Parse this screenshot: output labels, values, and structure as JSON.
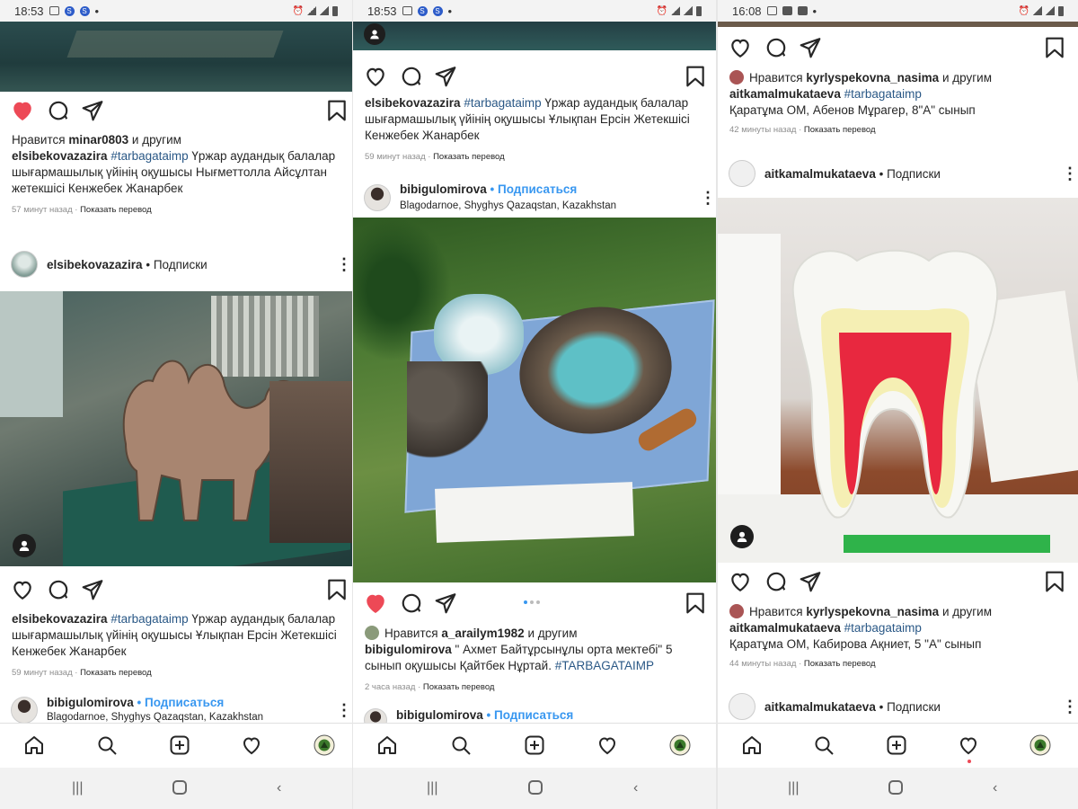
{
  "icons": {
    "heart": "heart-icon",
    "comment": "comment-icon",
    "share": "share-icon",
    "bookmark": "bookmark-icon",
    "home": "home-icon",
    "search": "search-icon",
    "add": "add-icon",
    "activity": "activity-icon",
    "profile": "profile-avatar-icon",
    "person": "person-icon",
    "more": "more-icon"
  },
  "colors": {
    "liked": "#ed4956",
    "link": "#3897f0",
    "hashtag": "#2a5886"
  },
  "p1": {
    "time": "18:53",
    "post1": {
      "liked_by_prefix": "Нравится",
      "liked_by_user": "minar0803",
      "liked_by_suffix": "и другим",
      "author": "elsibekovazazira",
      "hashtag": "#tarbagataimp",
      "caption": "Үржар аудандық балалар шығармашылық үйінің оқушысы Нығметтолла Айсұлтан жетекшісі Кенжебек Жанарбек",
      "ago": "57 минут назад",
      "translate": "Показать перевод"
    },
    "post2": {
      "author": "elsibekovazazira",
      "status": "• Подписки",
      "hashtag": "#tarbagataimp",
      "caption": "Үржар аудандық балалар шығармашылық үйінің оқушысы Ұлықпан Ерсін Жетекшісі Кенжебек Жанарбек",
      "ago": "59 минут назад",
      "translate": "Показать перевод"
    },
    "post3": {
      "author": "bibigulomirova",
      "follow": "• Подписаться",
      "location": "Blagodarnoe, Shyghys Qazaqstan, Kazakhstan"
    }
  },
  "p2": {
    "time": "18:53",
    "post1": {
      "author": "elsibekovazazira",
      "hashtag": "#tarbagataimp",
      "caption": "Үржар аудандық балалар шығармашылық үйінің оқушысы Ұлықпан Ерсін Жетекшісі Кенжебек Жанарбек",
      "ago": "59 минут назад",
      "translate": "Показать перевод"
    },
    "post2": {
      "author": "bibigulomirova",
      "follow": "• Подписаться",
      "location": "Blagodarnoe, Shyghys Qazaqstan, Kazakhstan",
      "liked_by_prefix": "Нравится",
      "liked_by_user": "a_arailym1982",
      "liked_by_suffix": "и другим",
      "caption": "\" Ахмет Байтұрсынұлы орта мектебі\" 5 сынып оқушысы Қайтбек Нұртай.",
      "hashtag": "#TARBAGATAIMP",
      "ago": "2 часа назад",
      "translate": "Показать перевод",
      "carousel_slides": 3,
      "carousel_active": 1
    },
    "post3": {
      "author": "bibigulomirova",
      "follow": "• Подписаться"
    }
  },
  "p3": {
    "time": "16:08",
    "post1": {
      "liked_by_prefix": "Нравится",
      "liked_by_user": "kyrlyspekovna_nasima",
      "liked_by_suffix": "и другим",
      "author": "aitkamalmukataeva",
      "hashtag": "#tarbagataimp",
      "caption": "Қаратұма ОМ, Абенов Мұрагер, 8\"А\" сынып",
      "ago": "42 минуты назад",
      "translate": "Показать перевод"
    },
    "post2": {
      "author": "aitkamalmukataeva",
      "status": "• Подписки",
      "liked_by_prefix": "Нравится",
      "liked_by_user": "kyrlyspekovna_nasima",
      "liked_by_suffix": "и другим",
      "hashtag": "#tarbagataimp",
      "caption": "Қаратұма ОМ, Кабирова Ақниет, 5 \"А\" сынып",
      "ago": "44 минуты назад",
      "translate": "Показать перевод"
    },
    "post3": {
      "author": "aitkamalmukataeva",
      "status": "• Подписки"
    }
  }
}
